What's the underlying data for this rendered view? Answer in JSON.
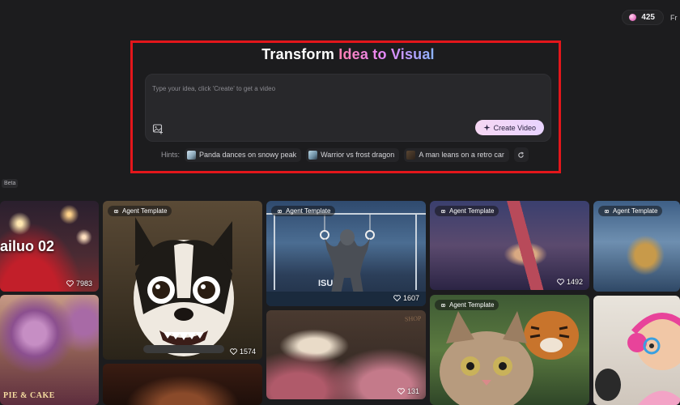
{
  "header": {
    "credits": "425",
    "plan_label": "Fr"
  },
  "hero": {
    "title_plain": "Transform ",
    "title_highlight": "Idea to Visual",
    "prompt_placeholder": "Type your idea, click 'Create' to get a video",
    "create_label": "Create Video",
    "hints_label": "Hints:",
    "hints": [
      {
        "label": "Panda dances on snowy peak"
      },
      {
        "label": "Warrior vs frost dragon"
      },
      {
        "label": "A man leans on a retro car"
      }
    ]
  },
  "beta_label": "Beta",
  "gallery": {
    "cards": [
      {
        "id": "hailuo",
        "overlay_text": "ailuo 02",
        "likes": "7983",
        "badge": ""
      },
      {
        "id": "rose-cake",
        "sign_text": "PIE & CAKE",
        "likes": "",
        "badge": ""
      },
      {
        "id": "dog",
        "badge": "Agent Template",
        "likes": "1574"
      },
      {
        "id": "dark-portrait",
        "badge": "",
        "likes": ""
      },
      {
        "id": "gorilla",
        "badge": "Agent Template",
        "likes": "1607"
      },
      {
        "id": "flower-shop",
        "shop_text": "SHOP",
        "badge": "",
        "likes": "131"
      },
      {
        "id": "climber-cat",
        "badge": "Agent Template",
        "likes": "1492"
      },
      {
        "id": "cat-tiger",
        "badge": "Agent Template",
        "likes": ""
      },
      {
        "id": "leopard",
        "badge": "Agent Template",
        "likes": ""
      },
      {
        "id": "girl-headphones",
        "badge": "",
        "likes": ""
      }
    ]
  },
  "colors": {
    "background": "#1c1c1e",
    "highlight_frame": "#e3161b",
    "create_button": "#f6d7f3"
  }
}
